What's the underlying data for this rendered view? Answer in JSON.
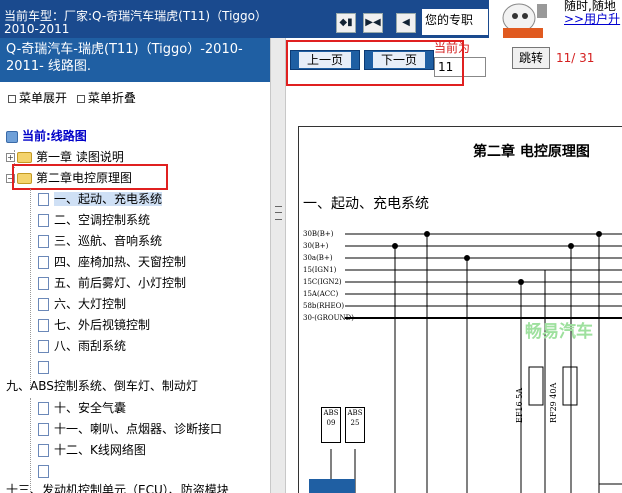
{
  "topbar": {
    "vehicle_line1": "当前车型：厂家:Q-奇瑞汽车瑞虎(T11)（Tiggo）",
    "vehicle_line2": "2010-2011",
    "btn_first": "◆▮",
    "btn_mid": "▶◀",
    "btn_prev": "◀",
    "welcome": "您的专职",
    "ad_line1": "随时,随地",
    "ad_link": ">>用户升"
  },
  "left": {
    "subtitle": "Q-奇瑞汽车-瑞虎(T11)（Tiggo）-2010-2011- 线路图.",
    "expand_all": "菜单展开",
    "collapse_all": "菜单折叠",
    "root_label": "当前:线路图",
    "tree": [
      {
        "label": "第一章 读图说明",
        "kind": "folder"
      },
      {
        "label": "第二章电控原理图",
        "kind": "folder"
      },
      {
        "label": "一、起动、充电系统",
        "kind": "page"
      },
      {
        "label": "二、空调控制系统",
        "kind": "page"
      },
      {
        "label": "三、巡航、音响系统",
        "kind": "page"
      },
      {
        "label": "四、座椅加热、天窗控制",
        "kind": "page"
      },
      {
        "label": "五、前后雾灯、小灯控制",
        "kind": "page"
      },
      {
        "label": "六、大灯控制",
        "kind": "page"
      },
      {
        "label": "七、外后视镜控制",
        "kind": "page"
      },
      {
        "label": "八、雨刮系统",
        "kind": "page"
      },
      {
        "label": "",
        "kind": "page"
      },
      {
        "label": "九、ABS控制系统、倒车灯、制动灯",
        "kind": "text"
      },
      {
        "label": "十、安全气囊",
        "kind": "page"
      },
      {
        "label": "十一、喇叭、点烟器、诊断接口",
        "kind": "page"
      },
      {
        "label": "十二、K线网络图",
        "kind": "page"
      },
      {
        "label": "",
        "kind": "page"
      },
      {
        "label": "十三、发动机控制单元（ECU）、防盗模块",
        "kind": "text"
      }
    ]
  },
  "pager": {
    "prev": "上一页",
    "next": "下一页",
    "current_label": "当前为",
    "current_value": "11",
    "jump": "跳转",
    "count": "11/ 31"
  },
  "doc": {
    "chapter": "第二章   电控原理图",
    "section": "一、起动、充电系统",
    "bus_labels": [
      "30B(B+)",
      "30(B+)",
      "30a(B+)",
      "15(IGN1)",
      "15C(IGN2)",
      "15A(ACC)",
      "58b(RHEO)",
      "30-(GROUND)"
    ],
    "watermark": "畅易汽车",
    "fuse1": "EF16   5A",
    "fuse2": "RF29   40A",
    "abs1": "ABS 09",
    "abs2": "ABS 25"
  },
  "colors": {
    "topbar": "#1a4a8e",
    "subtitle": "#1f5fa3",
    "highlight": "#e02020",
    "page_red": "#d42020"
  }
}
